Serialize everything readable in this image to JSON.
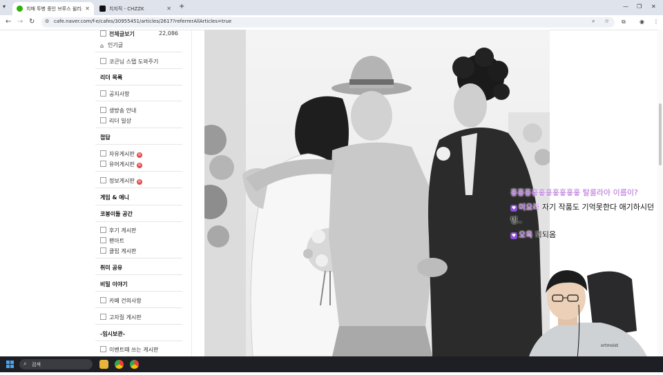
{
  "browser": {
    "tabs": [
      {
        "label": "치매 투병 중인 브루스 윌리스",
        "active": true
      },
      {
        "label": "치지직 - CHZZK",
        "active": false
      }
    ],
    "url": "cafe.naver.com/f-e/cafes/30955451/articles/2617?referrerAllArticles=true"
  },
  "sidebar": {
    "total_label": "전체글보기",
    "total_count": "22,086",
    "popular": "인기글",
    "korean_stamp": "코큰님 스탭 도와주기",
    "leader_header": "리더 목록",
    "notice": "공지사항",
    "broadcast": "생방송 안내",
    "leader_daily": "리더 일상",
    "lobby_header": "접답",
    "free_board": "자유게시판",
    "humor_board": "유머게시판",
    "info_board": "정보게시판",
    "game_header": "게임 & 애니",
    "creators_header": "코봉이들 공간",
    "review_board": "후기 게시판",
    "fanart": "팬아트",
    "clip_board": "클립 게시판",
    "hobby_header": "취미 공유",
    "secret_header": "비밀 이야기",
    "cafe_suggest": "카페 건의사항",
    "complaint_board": "고자질 게시판",
    "temp_header": "-임시보관-",
    "event_board": "이벤트때 쓰는 게시판"
  },
  "chat": {
    "line1": "흫흫흫흫흫흫흫흫흫흫 탈룰라아 이름이?",
    "line2_nick": "미요라",
    "line2_text": "자기 작품도 기억못한다 애기하시던",
    "line2_cont": "뎅..",
    "line3_nick": "오옥",
    "line3_text": "꾀되옴"
  },
  "taskbar": {
    "search_placeholder": "검색"
  },
  "colors": {
    "chat_highlight": "#b066d8",
    "badge_red": "#e5484d",
    "taskbar": "#1d1f24"
  }
}
